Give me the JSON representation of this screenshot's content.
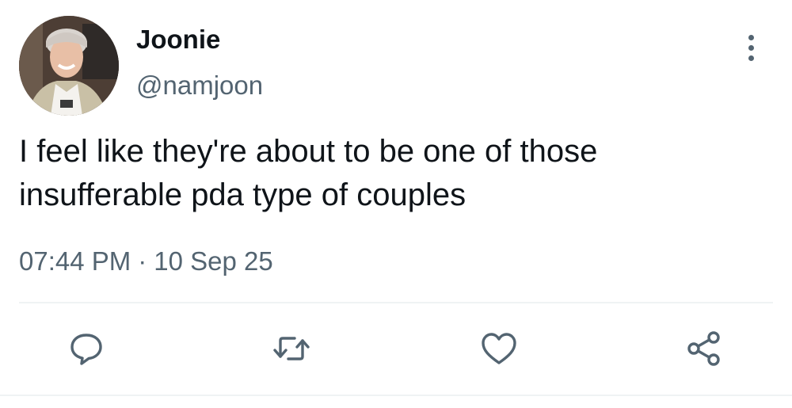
{
  "author": {
    "display_name": "Joonie",
    "handle": "@namjoon"
  },
  "tweet": {
    "text": "I feel like they're about to be one of those\ninsufferable pda type of couples",
    "time": "07:44 PM",
    "separator": "·",
    "date": "10 Sep 25"
  },
  "icons": {
    "more": "more-vertical-icon",
    "reply": "reply-icon",
    "retweet": "retweet-icon",
    "like": "heart-icon",
    "share": "share-icon"
  },
  "colors": {
    "text": "#0f1419",
    "secondary": "#536471",
    "divider": "#eff3f4"
  }
}
